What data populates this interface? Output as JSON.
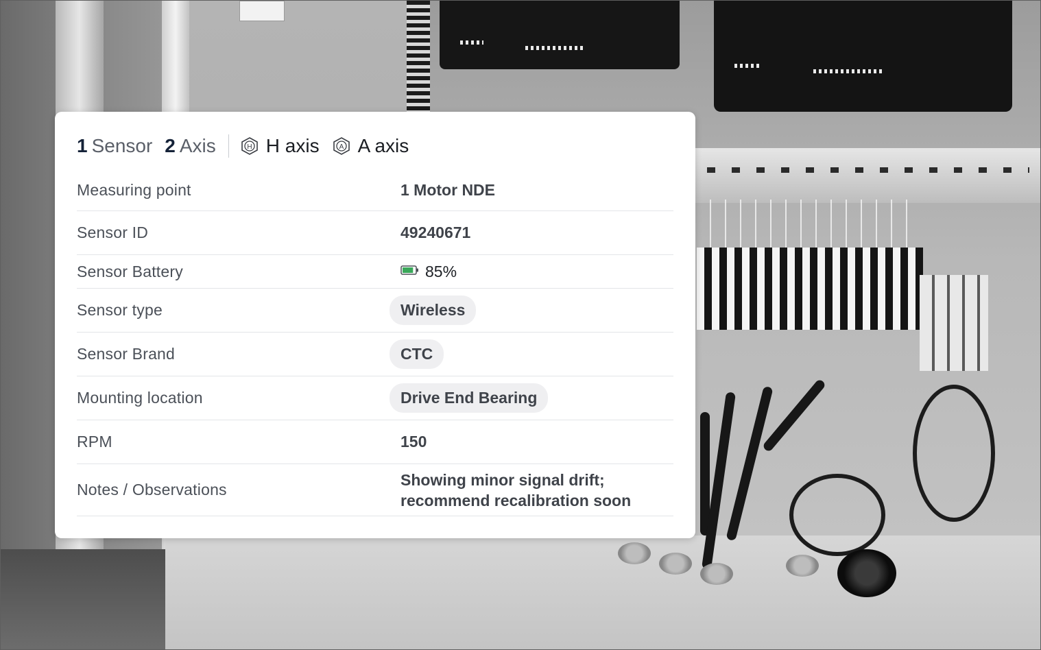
{
  "header": {
    "sensor_count": "1",
    "sensor_label": "Sensor",
    "axis_count": "2",
    "axis_label": "Axis",
    "axes": [
      {
        "icon": "h-axis-hexagon-icon",
        "label": "H axis"
      },
      {
        "icon": "a-axis-hexagon-icon",
        "label": "A axis"
      }
    ]
  },
  "details": {
    "measuring_point": {
      "label": "Measuring point",
      "value": "1 Motor NDE"
    },
    "sensor_id": {
      "label": "Sensor ID",
      "value": "49240671"
    },
    "battery": {
      "label": "Sensor Battery",
      "value": "85%",
      "level": 0.85,
      "icon": "battery-icon",
      "color": "#3aa85a"
    },
    "sensor_type": {
      "label": "Sensor type",
      "value": "Wireless"
    },
    "sensor_brand": {
      "label": "Sensor Brand",
      "value": "CTC"
    },
    "mounting_location": {
      "label": "Mounting location",
      "value": "Drive End Bearing"
    },
    "rpm": {
      "label": "RPM",
      "value": "150"
    },
    "notes": {
      "label": "Notes / Observations",
      "line1": "Showing minor signal drift;",
      "line2": "recommend recalibration soon"
    }
  },
  "colors": {
    "card_bg": "#ffffff",
    "pill_bg": "#efeff1",
    "count_text": "#152238",
    "label_text": "#4b5058"
  }
}
